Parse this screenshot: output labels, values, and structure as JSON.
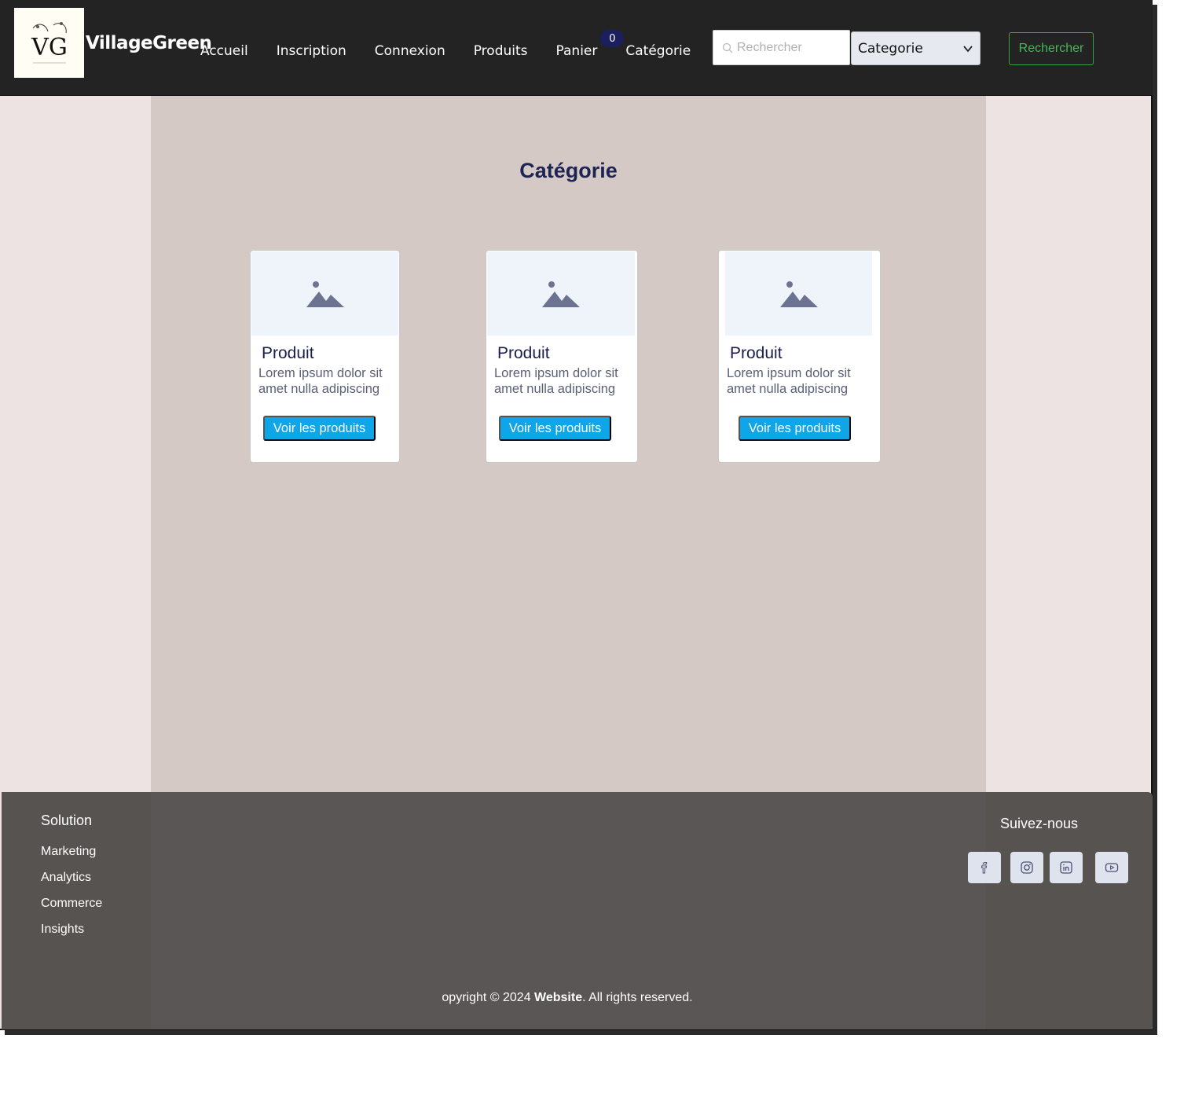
{
  "header": {
    "logo_text": "VG",
    "brand": "VillageGreen",
    "nav": [
      {
        "label": "Accueil"
      },
      {
        "label": "Inscription"
      },
      {
        "label": "Connexion"
      },
      {
        "label": "Produits"
      },
      {
        "label": "Panier"
      },
      {
        "label": "Catégorie"
      }
    ],
    "cart_count": "0",
    "search_placeholder": "Rechercher",
    "category_select": "Categorie",
    "search_button": "Rechercher"
  },
  "main": {
    "title": "Catégorie",
    "cards": [
      {
        "name": "Produit",
        "desc": "Lorem ipsum dolor sit amet nulla adipiscing",
        "button": "Voir les produits"
      },
      {
        "name": "Produit",
        "desc": "Lorem ipsum dolor sit amet nulla adipiscing",
        "button": "Voir les produits"
      },
      {
        "name": "Produit",
        "desc": "Lorem ipsum dolor sit amet nulla adipiscing",
        "button": "Voir les produits"
      }
    ]
  },
  "footer": {
    "solution_heading": "Solution",
    "links": [
      "Marketing",
      "Analytics",
      "Commerce",
      "Insights"
    ],
    "follow_heading": "Suivez-nous",
    "social": [
      "facebook-icon",
      "instagram-icon",
      "linkedin-icon",
      "youtube-icon"
    ],
    "copyright_prefix": "opyright © 2024 ",
    "copyright_site": "Website",
    "copyright_suffix": ". All rights reserved."
  }
}
